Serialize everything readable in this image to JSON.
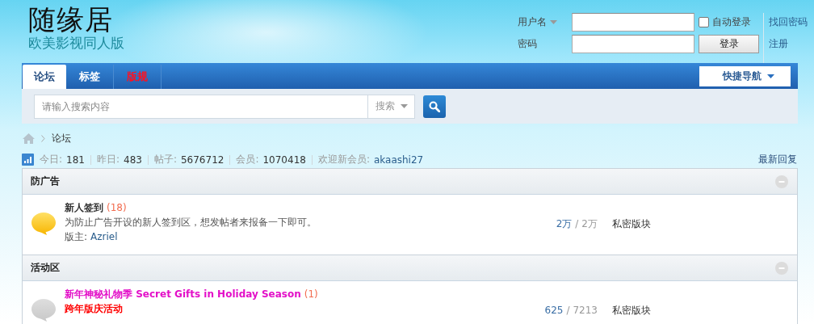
{
  "logo": {
    "title": "随缘居",
    "subtitle": "欧美影视同人版"
  },
  "login": {
    "username_label": "用户名",
    "password_label": "密码",
    "remember": {
      "label": "自动登录",
      "checked": false
    },
    "submit": "登录",
    "links": [
      "找回密码",
      "注册"
    ]
  },
  "nav": {
    "tabs": [
      {
        "label": "论坛",
        "selected": true,
        "kind": "normal"
      },
      {
        "label": "标签",
        "selected": false,
        "kind": "normal"
      },
      {
        "label": "版规",
        "selected": false,
        "kind": "alert"
      }
    ],
    "quick_nav": "快捷导航"
  },
  "search": {
    "placeholder": "请输入搜索内容",
    "scope": "搜索"
  },
  "breadcrumb": [
    "论坛"
  ],
  "stats": [
    {
      "label": "今日:",
      "value": "181",
      "kind": "number"
    },
    {
      "label": "昨日:",
      "value": "483",
      "kind": "number"
    },
    {
      "label": "帖子:",
      "value": "5676712",
      "kind": "number"
    },
    {
      "label": "会员:",
      "value": "1070418",
      "kind": "number"
    },
    {
      "label": "欢迎新会员:",
      "value": "akaashi27",
      "kind": "link"
    }
  ],
  "latest_link": "最新回复",
  "sections": [
    {
      "title": "防广告",
      "expanded": true,
      "forums": [
        {
          "name": "新人签到",
          "color": "#333333",
          "count": "(18)",
          "has_new": true,
          "description": "为防止广告开设的新人签到区，想发帖者来报备一下即可。",
          "kind": "plain",
          "moderator_label": "版主:",
          "moderator": "Azriel",
          "threads": "2万",
          "separator": "/",
          "posts": "2万",
          "last_post": "私密版块"
        }
      ]
    },
    {
      "title": "活动区",
      "expanded": true,
      "forums": [
        {
          "name": "新年神秘礼物季 Secret Gifts in Holiday Season",
          "color": "#e30fc8",
          "count": "(1)",
          "has_new": false,
          "description": "跨年版庆活动",
          "kind": "alert",
          "threads": "625",
          "separator": "/",
          "posts": "7213",
          "last_post": "私密版块"
        }
      ]
    }
  ]
}
